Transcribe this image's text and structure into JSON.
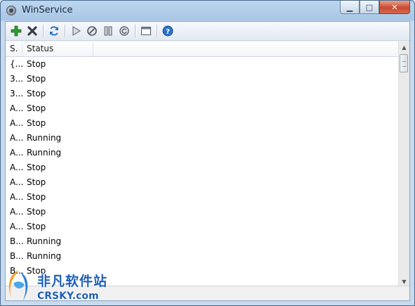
{
  "window": {
    "title": "WinService"
  },
  "caption_buttons": {
    "minimize": "▁",
    "maximize": "□",
    "close": "✕"
  },
  "toolbar": {
    "buttons": [
      {
        "name": "add-icon"
      },
      {
        "name": "delete-icon"
      },
      {
        "name": "refresh-icon"
      },
      {
        "name": "start-icon"
      },
      {
        "name": "stop-icon"
      },
      {
        "name": "pause-icon"
      },
      {
        "name": "restart-icon"
      },
      {
        "name": "window-icon"
      },
      {
        "name": "help-icon"
      }
    ]
  },
  "list": {
    "columns": [
      "S.",
      "Status"
    ],
    "rows": [
      {
        "name": "{...",
        "status": "Stop"
      },
      {
        "name": "3...",
        "status": "Stop"
      },
      {
        "name": "3...",
        "status": "Stop"
      },
      {
        "name": "A...",
        "status": "Stop"
      },
      {
        "name": "A...",
        "status": "Stop"
      },
      {
        "name": "A...",
        "status": "Running"
      },
      {
        "name": "A...",
        "status": "Running"
      },
      {
        "name": "A...",
        "status": "Stop"
      },
      {
        "name": "A...",
        "status": "Stop"
      },
      {
        "name": "A...",
        "status": "Stop"
      },
      {
        "name": "A...",
        "status": "Stop"
      },
      {
        "name": "A...",
        "status": "Stop"
      },
      {
        "name": "B...",
        "status": "Running"
      },
      {
        "name": "B...",
        "status": "Running"
      },
      {
        "name": "B...",
        "status": "Stop"
      }
    ]
  },
  "watermark": {
    "chinese": "非凡软件站",
    "english": "CRSKY.com"
  },
  "colors": {
    "accent": "#1f5fb8",
    "add": "#2e9a2e",
    "help": "#2a72c8"
  }
}
